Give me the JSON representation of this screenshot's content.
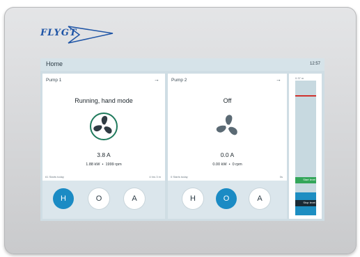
{
  "brand": {
    "logo_text": "FLYGT",
    "color": "#1f55a6"
  },
  "header": {
    "title": "Home",
    "time": "12:57"
  },
  "pumps": [
    {
      "name": "Pump 1",
      "status": "Running, hand mode",
      "current": "3.8 A",
      "power": "1.88 kW",
      "speed": "1999 rpm",
      "starts": "61 Starts today",
      "runtime": "4 hrs 3 m",
      "fan_state": "running",
      "modes": [
        "H",
        "O",
        "A"
      ],
      "active_mode": "H"
    },
    {
      "name": "Pump 2",
      "status": "Off",
      "current": "0.0 A",
      "power": "0.00 kW",
      "speed": "0 rpm",
      "starts": "0 Starts today",
      "runtime": "0s",
      "fan_state": "off",
      "modes": [
        "H",
        "O",
        "A"
      ],
      "active_mode": "O"
    }
  ],
  "level": {
    "value_label": "0.37 m",
    "start_label": "Start level",
    "stop_label": "Stop level",
    "water_fraction": 0.17
  },
  "colors": {
    "active_button": "#1b8bc4",
    "running_ring": "#1f7a5c",
    "alarm_line": "#d0312d",
    "start_band": "#33a65a"
  },
  "icons": [
    "fan-icon",
    "arrow-right-icon"
  ],
  "separator": "•"
}
